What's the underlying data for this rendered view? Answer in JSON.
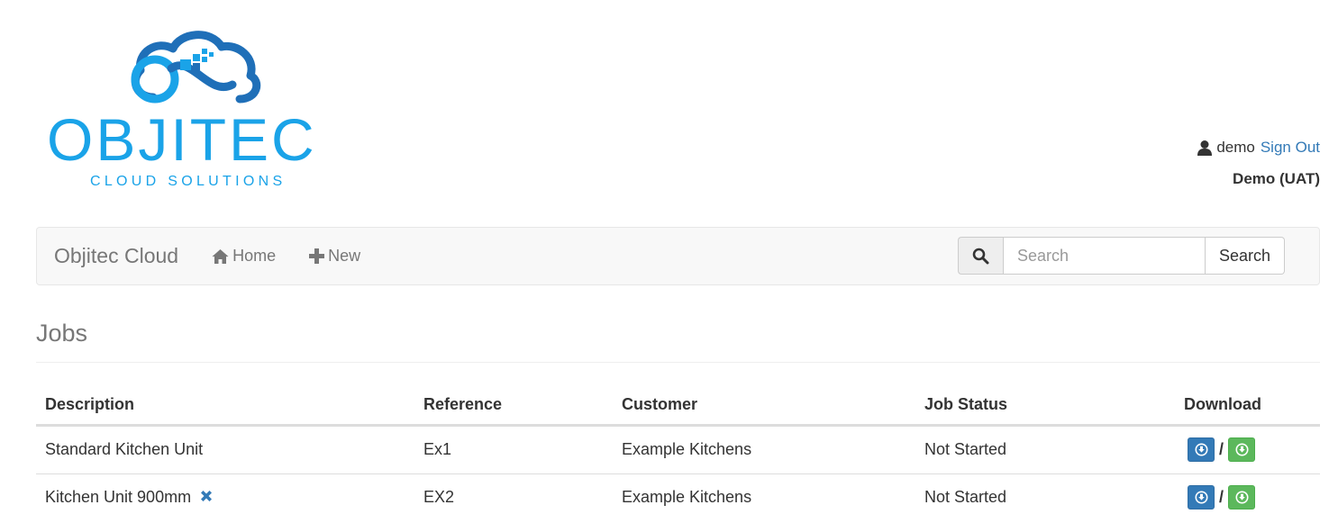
{
  "header": {
    "logo": {
      "title": "OBJITEC",
      "subtitle": "CLOUD SOLUTIONS",
      "icon": "cloud-infinity-logo",
      "colors": {
        "primary": "#1aa3e8",
        "dark": "#1f6fb8"
      }
    },
    "user": {
      "icon": "user-icon",
      "username": "demo",
      "sign_out_label": "Sign Out",
      "tenant": "Demo (UAT)"
    }
  },
  "navbar": {
    "brand": "Objitec Cloud",
    "items": [
      {
        "label": "Home",
        "icon": "home-icon"
      },
      {
        "label": "New",
        "icon": "plus-icon"
      }
    ],
    "search": {
      "icon": "search-icon",
      "placeholder": "Search",
      "value": "",
      "button_label": "Search"
    }
  },
  "main": {
    "title": "Jobs",
    "table": {
      "columns": [
        "Description",
        "Reference",
        "Customer",
        "Job Status",
        "Download"
      ],
      "rows": [
        {
          "description": "Standard Kitchen Unit",
          "reference": "Ex1",
          "customer": "Example Kitchens",
          "status": "Not Started",
          "removable": false
        },
        {
          "description": "Kitchen Unit 900mm",
          "reference": "EX2",
          "customer": "Example Kitchens",
          "status": "Not Started",
          "removable": true
        }
      ],
      "download": {
        "separator": "/",
        "primary_icon": "download-circle-icon",
        "secondary_icon": "download-circle-icon",
        "colors": {
          "primary": "#337ab7",
          "secondary": "#5cb85c"
        }
      },
      "remove_icon": "remove-x-icon",
      "remove_color": "#337ab7"
    }
  }
}
